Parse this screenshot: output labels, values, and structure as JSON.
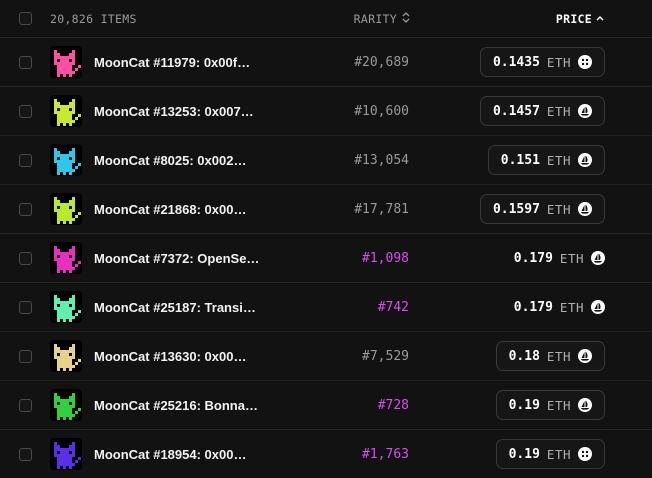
{
  "header": {
    "count_label": "20,826 ITEMS",
    "rarity_label": "RARITY",
    "price_label": "PRICE"
  },
  "rows": [
    {
      "name": "MoonCat #11979: 0x00f…",
      "rarity": "#20,689",
      "rare": false,
      "price": "0.1435",
      "currency": "ETH",
      "boxed": true,
      "icon": "blur-icon",
      "color": "#ff4fa3"
    },
    {
      "name": "MoonCat #13253: 0x007…",
      "rarity": "#10,600",
      "rare": false,
      "price": "0.1457",
      "currency": "ETH",
      "boxed": true,
      "icon": "opensea-icon",
      "color": "#c8e832"
    },
    {
      "name": "MoonCat #8025: 0x002…",
      "rarity": "#13,054",
      "rare": false,
      "price": "0.151",
      "currency": "ETH",
      "boxed": true,
      "icon": "opensea-icon",
      "color": "#2fc6e8"
    },
    {
      "name": "MoonCat #21868: 0x00…",
      "rarity": "#17,781",
      "rare": false,
      "price": "0.1597",
      "currency": "ETH",
      "boxed": true,
      "icon": "opensea-icon",
      "color": "#b9e82f"
    },
    {
      "name": "MoonCat #7372: OpenSe…",
      "rarity": "#1,098",
      "rare": true,
      "price": "0.179",
      "currency": "ETH",
      "boxed": false,
      "icon": "opensea-icon",
      "color": "#e82fc0"
    },
    {
      "name": "MoonCat #25187: Transi…",
      "rarity": "#742",
      "rare": true,
      "price": "0.179",
      "currency": "ETH",
      "boxed": false,
      "icon": "opensea-icon",
      "color": "#5ff0b0"
    },
    {
      "name": "MoonCat #13630: 0x00…",
      "rarity": "#7,529",
      "rare": false,
      "price": "0.18",
      "currency": "ETH",
      "boxed": true,
      "icon": "opensea-icon",
      "color": "#e8d28a"
    },
    {
      "name": "MoonCat #25216: Bonna…",
      "rarity": "#728",
      "rare": true,
      "price": "0.19",
      "currency": "ETH",
      "boxed": true,
      "icon": "opensea-icon",
      "color": "#2fd23a"
    },
    {
      "name": "MoonCat #18954: 0x00…",
      "rarity": "#1,763",
      "rare": true,
      "price": "0.19",
      "currency": "ETH",
      "boxed": true,
      "icon": "blur-icon",
      "color": "#5a2fe8"
    }
  ],
  "colors": {
    "background": "#121212",
    "rare": "#d84ef0",
    "border": "#242424"
  }
}
